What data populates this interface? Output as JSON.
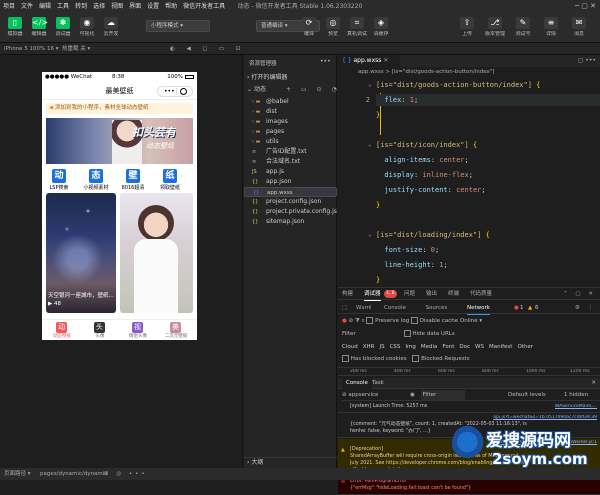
{
  "menu": [
    "项目",
    "文件",
    "编辑",
    "工具",
    "转到",
    "选择",
    "视图",
    "界面",
    "设置",
    "帮助",
    "微信开发者工具"
  ],
  "window_title": "动态 - 微信开发者工具 Stable 1.06.2303220",
  "toolbar": {
    "left": [
      {
        "label": "模拟器",
        "icon": "phone-icon"
      },
      {
        "label": "编辑器",
        "icon": "code-icon"
      },
      {
        "label": "调试器",
        "icon": "bug-icon"
      },
      {
        "label": "可视化",
        "icon": "eye-icon"
      },
      {
        "label": "云开发",
        "icon": "cloud-icon"
      }
    ],
    "mode_select": "小程序模式",
    "compile_select": "普通编译",
    "mid": [
      {
        "label": "编译",
        "icon": "refresh-icon"
      },
      {
        "label": "预览",
        "icon": "preview-icon"
      },
      {
        "label": "真机调试",
        "icon": "device-icon"
      },
      {
        "label": "清缓存",
        "icon": "clear-icon"
      }
    ],
    "right": [
      {
        "label": "上传",
        "icon": "upload-icon"
      },
      {
        "label": "版本管理",
        "icon": "version-icon"
      },
      {
        "label": "测试号",
        "icon": "test-icon"
      },
      {
        "label": "详情",
        "icon": "detail-icon"
      },
      {
        "label": "消息",
        "icon": "message-icon"
      }
    ]
  },
  "subbar": {
    "device": "iPhone 5 100% 16 ▾",
    "hot_reload": "热重载 关 ▾"
  },
  "phone": {
    "carrier": "●●●●● WeChat",
    "time": "8:38",
    "battery": "100%",
    "nav_title": "最美壁纸",
    "notice": "添加到我的小程序，素材全球动态壁纸",
    "banner_text": "扣头芸有",
    "banner_sub": "动态壁纸",
    "quick": [
      {
        "char": "动",
        "label": "LSP搜索"
      },
      {
        "char": "态",
        "label": "小视频素材"
      },
      {
        "char": "壁",
        "label": "8016超清"
      },
      {
        "char": "纸",
        "label": "领取壁纸"
      }
    ],
    "card_text": "天空银河一座城市，壁纸...",
    "card_count": "48",
    "tabs": [
      {
        "char": "动",
        "label": "动态壁纸"
      },
      {
        "char": "头",
        "label": "头像"
      },
      {
        "char": "视",
        "label": "情侣头像"
      },
      {
        "char": "美",
        "label": "二次元壁纸"
      }
    ]
  },
  "explorer": {
    "header": "资源管理器",
    "open_editors": "打开的编辑器",
    "section": "动态",
    "items": [
      {
        "name": "@babel",
        "type": "folder"
      },
      {
        "name": "dist",
        "type": "folder"
      },
      {
        "name": "images",
        "type": "folder"
      },
      {
        "name": "pages",
        "type": "folder"
      },
      {
        "name": "utils",
        "type": "folder"
      },
      {
        "name": "广告ID配置.txt",
        "type": "txt"
      },
      {
        "name": "合法域名.txt",
        "type": "txt"
      },
      {
        "name": "app.js",
        "type": "js"
      },
      {
        "name": "app.json",
        "type": "json"
      },
      {
        "name": "app.wxss",
        "type": "wxss"
      },
      {
        "name": "project.config.json",
        "type": "json"
      },
      {
        "name": "project.private.config.js...",
        "type": "json"
      },
      {
        "name": "sitemap.json",
        "type": "json"
      }
    ],
    "outline": "大纲"
  },
  "editor": {
    "tab": "app.wxss",
    "breadcrumb": "app.wxss > [is=\"dist/goods-action-button/index\"]",
    "lines": [
      {
        "n": "",
        "parts": [
          [
            "sel",
            "[is=\"dist/goods-action-button/index\"]"
          ],
          [
            "brace",
            " {"
          ]
        ]
      },
      {
        "n": "2",
        "parts": [
          [
            "prop",
            "  flex"
          ],
          [
            "punc",
            ": "
          ],
          [
            "val",
            "1"
          ],
          [
            "punc",
            ";"
          ]
        ]
      },
      {
        "n": "",
        "parts": [
          [
            "brace",
            "}"
          ]
        ]
      },
      {
        "n": "",
        "parts": [
          [
            "plain",
            ""
          ]
        ]
      },
      {
        "n": "",
        "parts": [
          [
            "sel",
            "[is=\"dist/icon/index\"]"
          ],
          [
            "brace",
            " {"
          ]
        ]
      },
      {
        "n": "",
        "parts": [
          [
            "prop",
            "  align-items"
          ],
          [
            "punc",
            ": "
          ],
          [
            "val",
            "center"
          ],
          [
            "punc",
            ";"
          ]
        ]
      },
      {
        "n": "",
        "parts": [
          [
            "prop",
            "  display"
          ],
          [
            "punc",
            ": "
          ],
          [
            "val",
            "inline-flex"
          ],
          [
            "punc",
            ";"
          ]
        ]
      },
      {
        "n": "",
        "parts": [
          [
            "prop",
            "  justify-content"
          ],
          [
            "punc",
            ": "
          ],
          [
            "val",
            "center"
          ],
          [
            "punc",
            ";"
          ]
        ]
      },
      {
        "n": "",
        "parts": [
          [
            "brace",
            "}"
          ]
        ]
      },
      {
        "n": "",
        "parts": [
          [
            "plain",
            ""
          ]
        ]
      },
      {
        "n": "",
        "parts": [
          [
            "sel",
            "[is=\"dist/loading/index\"]"
          ],
          [
            "brace",
            " {"
          ]
        ]
      },
      {
        "n": "",
        "parts": [
          [
            "prop",
            "  font-size"
          ],
          [
            "punc",
            ": "
          ],
          [
            "val",
            "0"
          ],
          [
            "punc",
            ";"
          ]
        ]
      },
      {
        "n": "",
        "parts": [
          [
            "prop",
            "  line-height"
          ],
          [
            "punc",
            ": "
          ],
          [
            "val",
            "1"
          ],
          [
            "punc",
            ";"
          ]
        ]
      },
      {
        "n": "",
        "parts": [
          [
            "brace",
            "}"
          ]
        ]
      }
    ]
  },
  "debug": {
    "panel_tabs": [
      "构建",
      "调试器",
      "问题",
      "输出",
      "终端",
      "代码质量"
    ],
    "debugger_badge": "1, 6",
    "inner_tabs": [
      "Wxml",
      "Console",
      "Sources",
      "Network"
    ],
    "active_inner": "Network",
    "error_count": "1",
    "warn_count": "6",
    "options": [
      "Preserve log",
      "Disable cache",
      "Online"
    ],
    "filter_label": "Filter",
    "hide_urls": "Hide data URLs",
    "types": [
      "Cloud",
      "XHR",
      "JS",
      "CSS",
      "Img",
      "Media",
      "Font",
      "Doc",
      "WS",
      "Manifest",
      "Other"
    ],
    "blocked": [
      "Has blocked cookies",
      "Blocked Requests"
    ],
    "timeline": [
      "200 ms",
      "400 ms",
      "600 ms",
      "800 ms",
      "1000 ms",
      "1200 ms"
    ],
    "console_tabs": [
      "Console",
      "Task"
    ],
    "context": "appservice",
    "console_filter": "Filter",
    "levels": "Default levels",
    "hidden": "1 hidden",
    "logs": [
      {
        "kind": "info",
        "text": "[system] Launch Time: 5257 ms",
        "src": "WAServiceMainC..."
      },
      {
        "kind": "info",
        "text": "{comment: \"元气动态壁纸\", count: 1, createdAt: \"2022-05-03 11:16:13\", is\nhenhe: false, keyword: \"办门\", …}",
        "src": "api.js?t=wechat&s=16.0517094ac7cd0f39:39"
      },
      {
        "kind": "warn",
        "text": "[Deprecation]\nSharedArrayBuffer will require cross-origin isolation as of M92, around\nJuly 2021. See https://developer.chrome.com/blog/enabling-shared-array-b\nuffer/ for more details.",
        "src": "worker.js?libName=WA…celerateWorker.js:1"
      },
      {
        "kind": "error",
        "text": "Error: MiniProgramError\n{\"errMsg\":\"hideLoading:fail:toast can't be found\"}",
        "src": ""
      }
    ]
  },
  "status": {
    "left": "页面路径 ▾",
    "path": "pages/dynamic/dynamic",
    "watermark": "爱搜源码网",
    "watermark_url": "2soym.com"
  },
  "colors": {
    "accent_green": "#07c160",
    "error_red": "#e04747",
    "warn_yellow": "#e6b422"
  }
}
